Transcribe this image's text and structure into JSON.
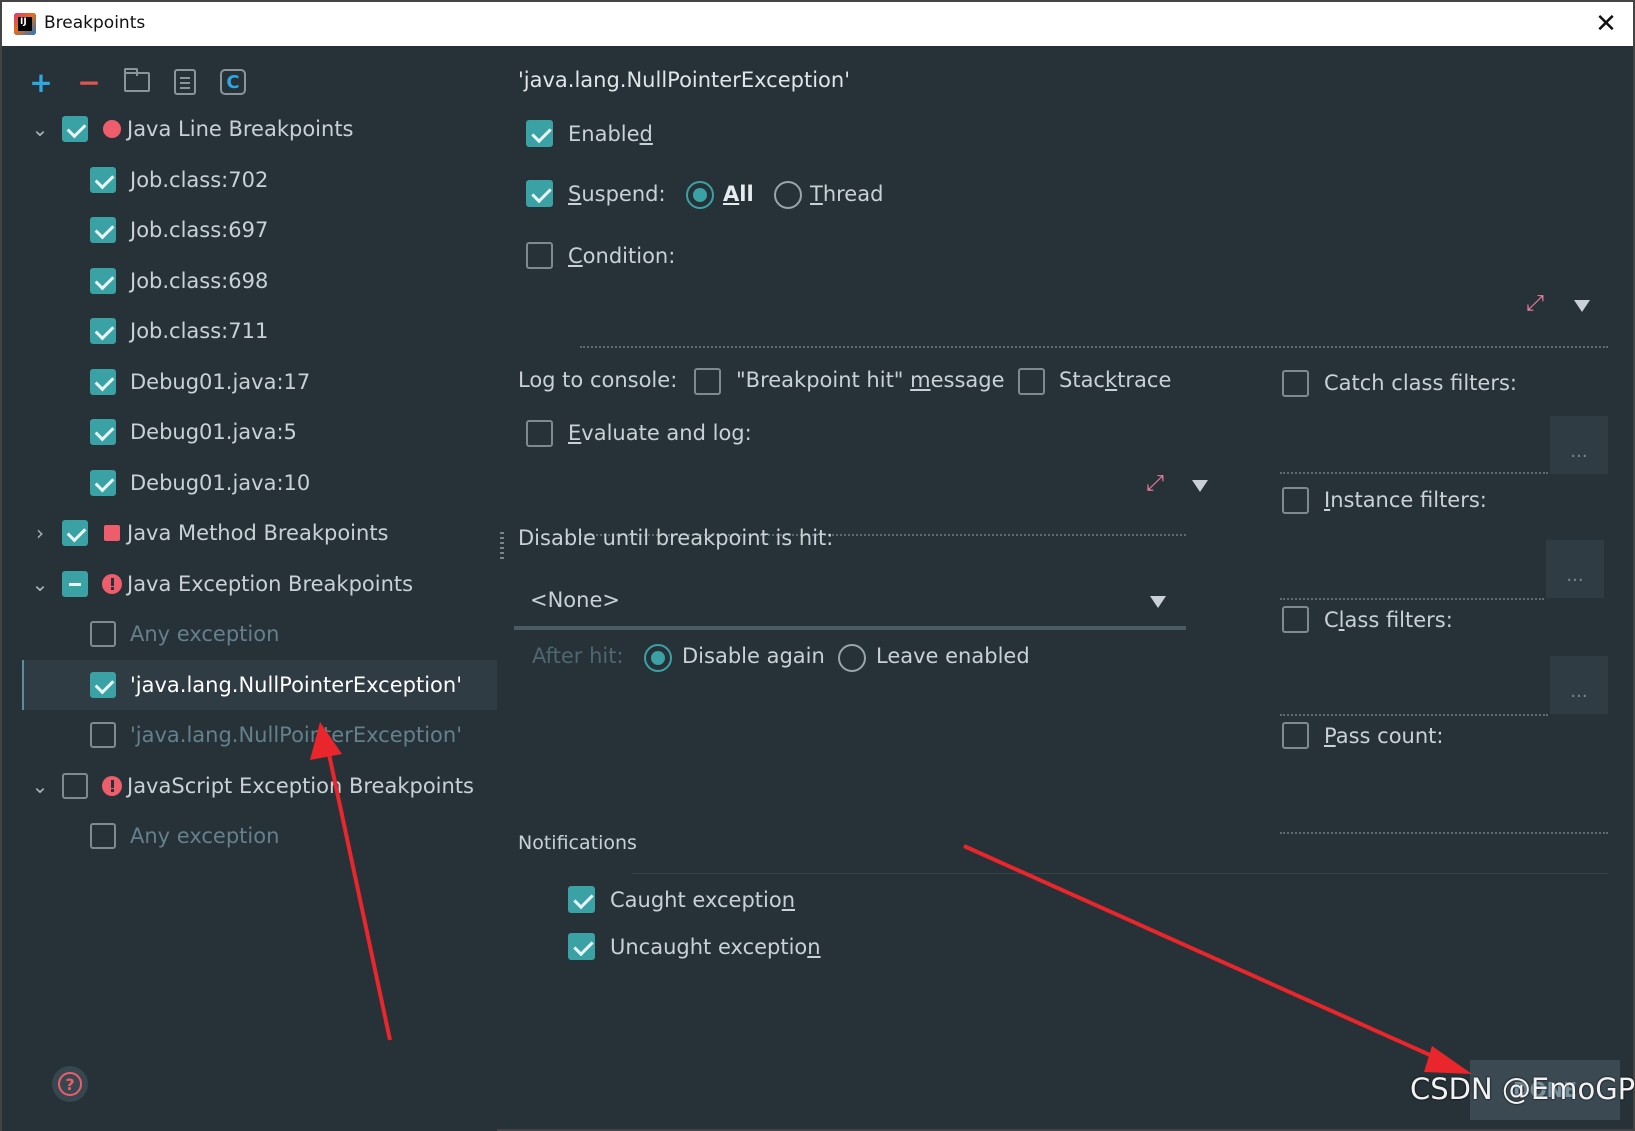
{
  "window": {
    "title": "Breakpoints",
    "close_glyph": "✕"
  },
  "toolbar": {
    "add": "+",
    "remove": "−",
    "class_glyph": "C"
  },
  "tree": [
    {
      "label": "Java Line Breakpoints",
      "checked": true,
      "expanded": true,
      "icon": "red-dot",
      "children": [
        {
          "label": "Job.class:702"
        },
        {
          "label": "Job.class:697"
        },
        {
          "label": "Job.class:698"
        },
        {
          "label": "Job.class:711"
        },
        {
          "label": "Debug01.java:17"
        },
        {
          "label": "Debug01.java:5"
        },
        {
          "label": "Debug01.java:10"
        }
      ]
    },
    {
      "label": "Java Method Breakpoints",
      "checked": true,
      "expanded": false,
      "icon": "red-square"
    },
    {
      "label": "Java Exception Breakpoints",
      "state": "mixed",
      "expanded": true,
      "icon": "exception",
      "children": [
        {
          "label": "Any exception",
          "checked": false
        },
        {
          "label": "'java.lang.NullPointerException'",
          "checked": true,
          "selected": true
        },
        {
          "label": "'java.lang.NullPointerException'",
          "checked": false
        }
      ]
    },
    {
      "label": "JavaScript Exception Breakpoints",
      "checked": false,
      "expanded": true,
      "icon": "exception",
      "children": [
        {
          "label": "Any exception",
          "checked": false
        }
      ]
    }
  ],
  "details": {
    "title": "'java.lang.NullPointerException'",
    "enabled": {
      "pre": "Enable",
      "u": "d",
      "post": ""
    },
    "suspend": {
      "label_u": "S",
      "label_rest": "uspend:",
      "all_u": "A",
      "all_rest": "ll",
      "thread_u": "T",
      "thread_rest": "hread"
    },
    "condition": {
      "u": "C",
      "rest": "ondition:"
    },
    "log_to_console": "Log to console:",
    "bp_hit_msg": {
      "pre": "\"Breakpoint hit\" ",
      "u": "m",
      "post": "essage"
    },
    "stacktrace": {
      "pre": "Stac",
      "u": "k",
      "post": "trace"
    },
    "evaluate": {
      "u": "E",
      "rest": "valuate and log:"
    },
    "disable_until": "Disable until breakpoint is hit:",
    "none_option": "<None>",
    "after_hit": "After hit:",
    "disable_again": "Disable again",
    "leave_enabled": "Leave enabled",
    "catch_filters": "Catch class filters:",
    "instance_filters": {
      "u": "I",
      "rest": "nstance filters:"
    },
    "class_filters": {
      "pre": "C",
      "u": "l",
      "post": "ass filters:"
    },
    "pass_count": {
      "u": "P",
      "rest": "ass count:"
    },
    "notifications": "Notifications",
    "caught": {
      "pre": "Caught exceptio",
      "u": "n",
      "post": ""
    },
    "uncaught": {
      "pre": "Uncaught exceptio",
      "u": "n",
      "post": ""
    },
    "ellipsis": "..."
  },
  "footer": {
    "done": "DONE",
    "help_glyph": "?",
    "watermark": "CSDN @EmoGP"
  },
  "colors": {
    "accent": "#3aa2a5",
    "red": "#ee5d6c",
    "bg": "#263238",
    "arrow": "#e8262b"
  }
}
